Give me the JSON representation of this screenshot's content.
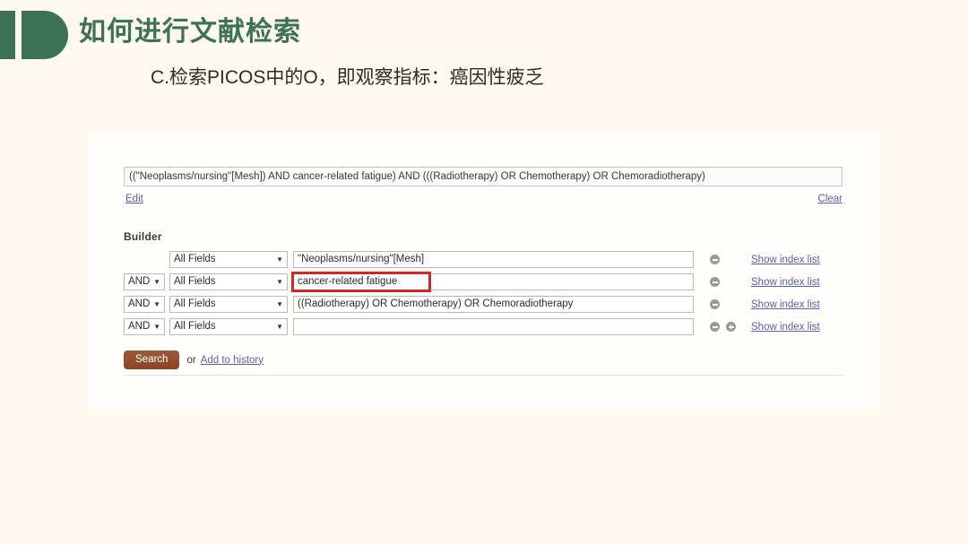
{
  "slide": {
    "logo_icon": "half-circle-d-logo",
    "title": "如何进行文献检索",
    "subtitle": "C.检索PICOS中的O，即观察指标：癌因性疲乏",
    "title_color": "#3d7256",
    "background_color": "#fdf9ee"
  },
  "pubmed": {
    "query": "((\"Neoplasms/nursing\"[Mesh]) AND cancer-related fatigue) AND (((Radiotherapy) OR Chemotherapy) OR Chemoradiotherapy)",
    "edit_label": "Edit",
    "clear_label": "Clear",
    "builder_label": "Builder",
    "search_button_label": "Search",
    "search_button_color": "#8a4426",
    "or_label": "or",
    "add_to_history_label": "Add to history",
    "link_color": "#5a5fa8",
    "highlight_color": "#d02724",
    "index_link_label": "Show index list",
    "rows": [
      {
        "operator": "",
        "field": "All Fields",
        "term": "\"Neoplasms/nursing\"[Mesh]",
        "index_link": "Show index list",
        "has_minus": true,
        "has_plus": false,
        "highlighted": false
      },
      {
        "operator": "AND",
        "field": "All Fields",
        "term": "cancer-related fatigue",
        "index_link": "Show index list",
        "has_minus": true,
        "has_plus": false,
        "highlighted": true
      },
      {
        "operator": "AND",
        "field": "All Fields",
        "term": "((Radiotherapy) OR Chemotherapy) OR Chemoradiotherapy",
        "index_link": "Show index list",
        "has_minus": true,
        "has_plus": false,
        "highlighted": false
      },
      {
        "operator": "AND",
        "field": "All Fields",
        "term": "",
        "index_link": "Show index list",
        "has_minus": true,
        "has_plus": true,
        "highlighted": false
      }
    ]
  }
}
